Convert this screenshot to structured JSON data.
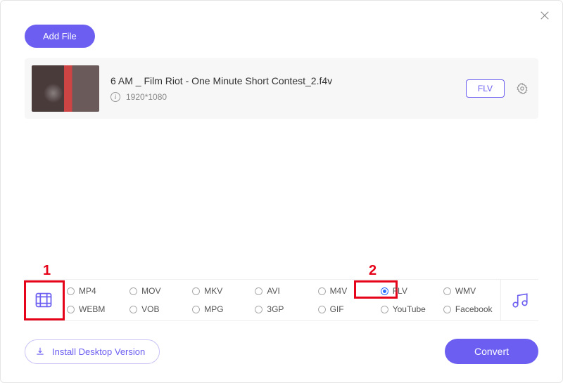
{
  "buttons": {
    "add_file": "Add File",
    "install": "Install Desktop Version",
    "convert": "Convert"
  },
  "file": {
    "title": "6 AM _ Film Riot - One Minute Short Contest_2.f4v",
    "resolution": "1920*1080",
    "format_badge": "FLV"
  },
  "annotations": {
    "one": "1",
    "two": "2"
  },
  "formats": {
    "row1": [
      {
        "label": "MP4",
        "checked": false
      },
      {
        "label": "MOV",
        "checked": false
      },
      {
        "label": "MKV",
        "checked": false
      },
      {
        "label": "AVI",
        "checked": false
      },
      {
        "label": "M4V",
        "checked": false
      },
      {
        "label": "FLV",
        "checked": true
      },
      {
        "label": "WMV",
        "checked": false
      }
    ],
    "row2": [
      {
        "label": "WEBM",
        "checked": false
      },
      {
        "label": "VOB",
        "checked": false
      },
      {
        "label": "MPG",
        "checked": false
      },
      {
        "label": "3GP",
        "checked": false
      },
      {
        "label": "GIF",
        "checked": false
      },
      {
        "label": "YouTube",
        "checked": false
      },
      {
        "label": "Facebook",
        "checked": false
      }
    ]
  }
}
